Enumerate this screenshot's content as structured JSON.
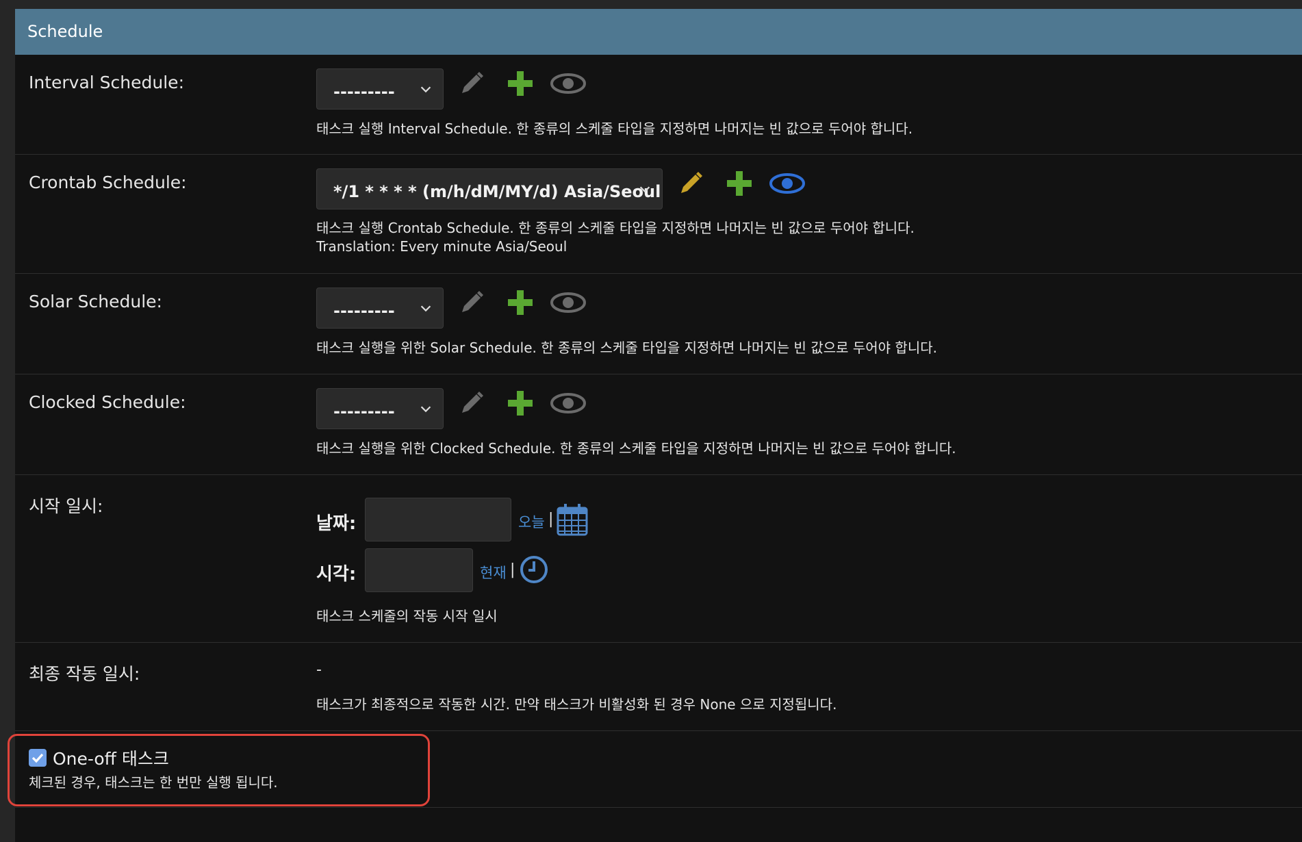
{
  "header": {
    "title": "Schedule"
  },
  "interval": {
    "label": "Interval Schedule:",
    "value": "---------",
    "help": "태스크 실행 Interval Schedule. 한 종류의 스케줄 타입을 지정하면 나머지는 빈 값으로 두어야 합니다."
  },
  "crontab": {
    "label": "Crontab Schedule:",
    "value": "*/1 * * * * (m/h/dM/MY/d) Asia/Seoul",
    "help": "태스크 실행 Crontab Schedule. 한 종류의 스케줄 타입을 지정하면 나머지는 빈 값으로 두어야 합니다.",
    "translation": "Translation: Every minute Asia/Seoul"
  },
  "solar": {
    "label": "Solar Schedule:",
    "value": "---------",
    "help": "태스크 실행을 위한 Solar Schedule. 한 종류의 스케줄 타입을 지정하면 나머지는 빈 값으로 두어야 합니다."
  },
  "clocked": {
    "label": "Clocked Schedule:",
    "value": "---------",
    "help": "태스크 실행을 위한 Clocked Schedule. 한 종류의 스케줄 타입을 지정하면 나머지는 빈 값으로 두어야 합니다."
  },
  "start": {
    "label": "시작 일시:",
    "date_label": "날짜:",
    "date_value": "",
    "today_link": "오늘",
    "time_label": "시각:",
    "time_value": "",
    "now_link": "현재",
    "separator": "|",
    "help": "태스크 스케줄의 작동 시작 일시"
  },
  "last_run": {
    "label": "최종 작동 일시:",
    "value": "-",
    "help": "태스크가 최종적으로 작동한 시간. 만약 태스크가 비활성화 된 경우 None 으로 지정됩니다."
  },
  "one_off": {
    "label": "One-off 태스크",
    "checked": true,
    "help": "체크된 경우, 태스크는 한 번만 실행 됩니다."
  },
  "colors": {
    "header": "#4f7891",
    "add_green": "#5aa832",
    "edit_active": "#c9a227",
    "view_active": "#2f6fd6",
    "icon_disabled": "#6b6b6b",
    "highlight": "#e0433a"
  }
}
